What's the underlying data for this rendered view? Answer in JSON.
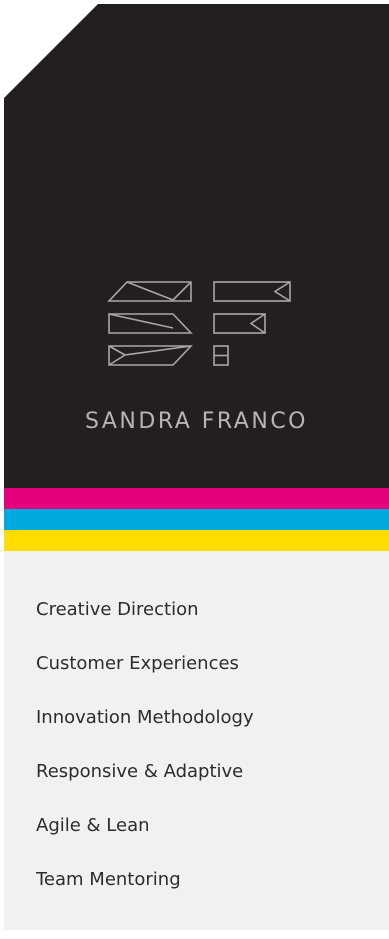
{
  "brand": {
    "name": "SANDRA FRANCO",
    "logo_icon": "sf-monogram-icon",
    "logo_color": "#a9a7a5"
  },
  "theme": {
    "dark": "#231f20",
    "light": "#f1f1f0",
    "text": "#2e2b2c",
    "stripes": [
      "#e5007e",
      "#00a9e0",
      "#ffdd00"
    ]
  },
  "services": [
    "Creative Direction",
    "Customer Experiences",
    "Innovation Methodology",
    "Responsive & Adaptive",
    "Agile & Lean",
    "Team Mentoring"
  ]
}
